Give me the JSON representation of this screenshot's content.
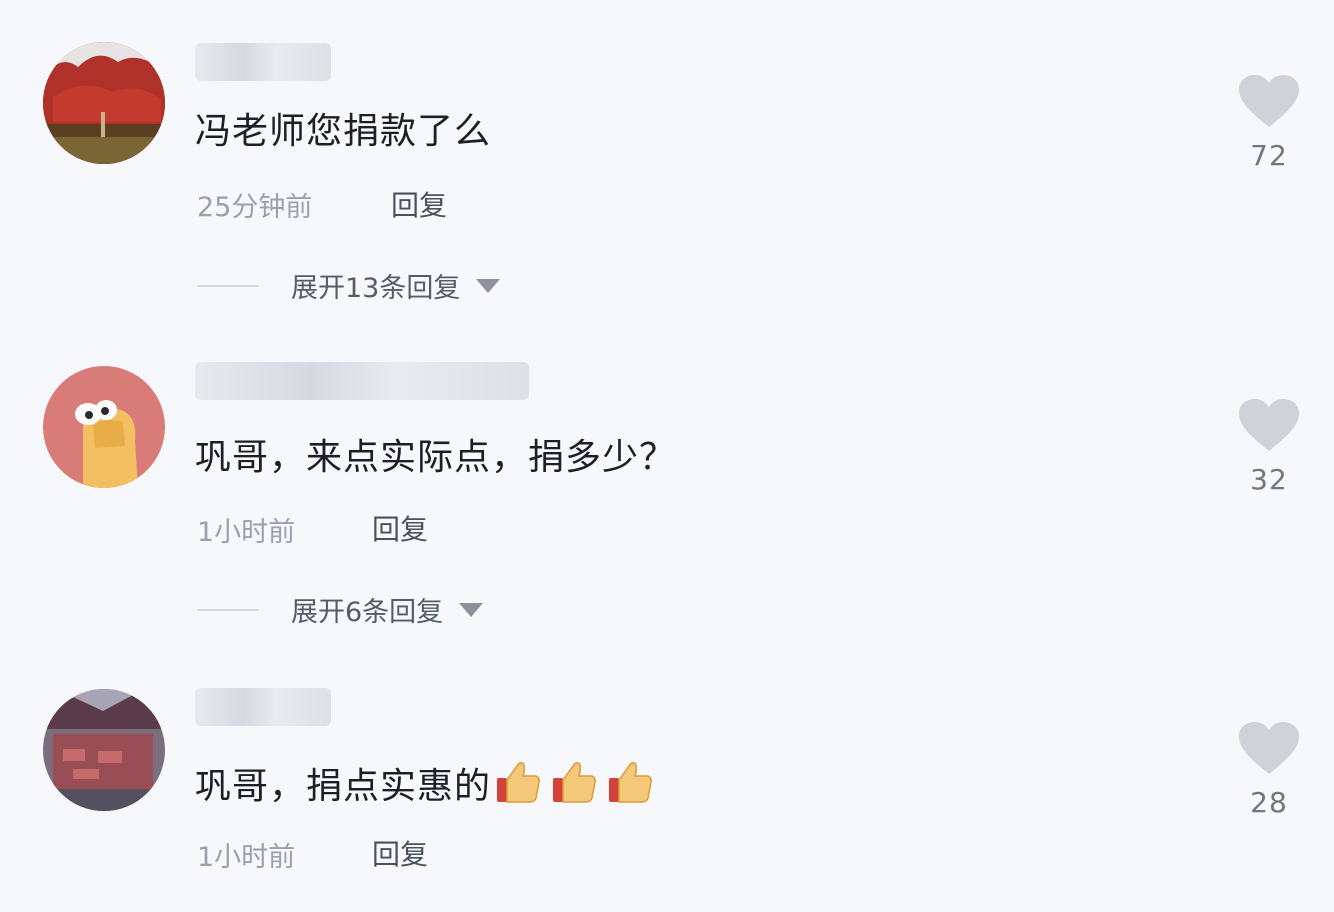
{
  "comments": [
    {
      "text": "冯老师您捐款了么",
      "time": "25分钟前",
      "reply_label": "回复",
      "expand_label": "展开13条回复",
      "likes": "72"
    },
    {
      "text": "巩哥，来点实际点，捐多少？",
      "time": "1小时前",
      "reply_label": "回复",
      "expand_label": "展开6条回复",
      "likes": "32"
    },
    {
      "text": "巩哥，捐点实惠的",
      "emoji": [
        "thumbs-up",
        "thumbs-up",
        "thumbs-up"
      ],
      "time": "1小时前",
      "reply_label": "回复",
      "likes": "28"
    }
  ],
  "colors": {
    "background": "#f7f8fc",
    "heart": "#cfd2d8",
    "muted_text": "#9aa0ad"
  },
  "icons": [
    "heart-icon",
    "chevron-down-icon",
    "thumbs-up-icon"
  ]
}
